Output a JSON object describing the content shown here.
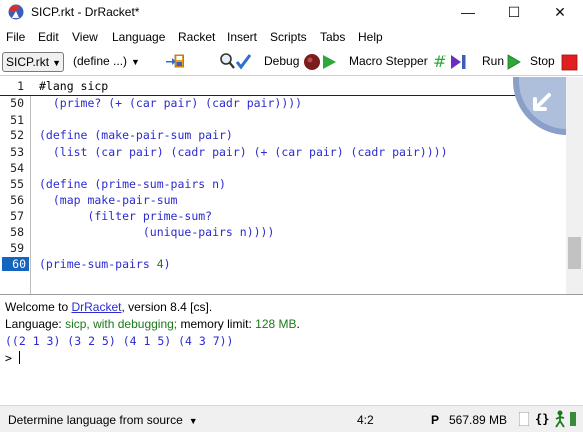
{
  "window": {
    "title": "SICP.rkt - DrRacket*",
    "controls": {
      "minimize": "—",
      "maximize": "☐",
      "close": "✕"
    }
  },
  "menu": [
    "File",
    "Edit",
    "View",
    "Language",
    "Racket",
    "Insert",
    "Scripts",
    "Tabs",
    "Help"
  ],
  "toolbar": {
    "file_selector": "SICP.rkt",
    "define_menu": "(define ...)",
    "debug": "Debug",
    "macro_stepper": "Macro Stepper",
    "run": "Run",
    "stop": "Stop"
  },
  "editor": {
    "lang_line": {
      "number": "1",
      "text": "#lang sicp"
    },
    "lines": [
      {
        "number": "50",
        "text": "  (prime? (+ (car pair) (cadr pair))))"
      },
      {
        "number": "51",
        "text": ""
      },
      {
        "number": "52",
        "text": "(define (make-pair-sum pair)"
      },
      {
        "number": "53",
        "text": "  (list (car pair) (cadr pair) (+ (car pair) (cadr pair))))"
      },
      {
        "number": "54",
        "text": ""
      },
      {
        "number": "55",
        "text": "(define (prime-sum-pairs n)"
      },
      {
        "number": "56",
        "text": "  (map make-pair-sum"
      },
      {
        "number": "57",
        "text": "       (filter prime-sum?"
      },
      {
        "number": "58",
        "text": "               (unique-pairs n))))"
      },
      {
        "number": "59",
        "text": ""
      },
      {
        "number": "60",
        "text": "(prime-sum-pairs 4)"
      }
    ],
    "current_line": "60",
    "colors": {
      "code": "#2b2bd0",
      "number_literal": "#1a7a1a",
      "current_line_bg": "#1565c0"
    }
  },
  "repl": {
    "welcome_prefix": "Welcome to ",
    "welcome_link": "DrRacket",
    "welcome_suffix": ", version 8.4 [cs].",
    "language_prefix": "Language: ",
    "language_value": "sicp, with debugging;",
    "memory_prefix": " memory limit: ",
    "memory_value": "128 MB",
    "memory_suffix": ".",
    "output": "((2 1 3) (3 2 5) (4 1 5) (4 3 7))",
    "prompt": "> "
  },
  "status": {
    "language_mode": "Determine language from source",
    "position": "4:2",
    "memory_indicator": "P",
    "memory": "567.89 MB"
  }
}
